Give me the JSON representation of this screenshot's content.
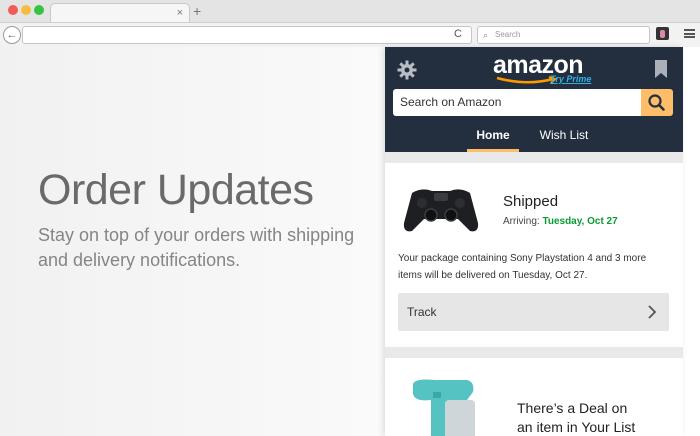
{
  "browser": {
    "traffic_lights": [
      "#ee5c55",
      "#f6bd45",
      "#33c441"
    ],
    "tab_close": "×",
    "new_tab": "+",
    "back_glyph": "←",
    "reload_glyph": "C",
    "search_icon": "search-icon",
    "search_placeholder": "Search"
  },
  "hero": {
    "title": "Order Updates",
    "subtitle": "Stay on top of your orders with shipping and delivery notifications."
  },
  "popup": {
    "logo_text": "amazon",
    "prime_link": "Try Prime",
    "search_placeholder": "Search on Amazon",
    "tabs": [
      {
        "label": "Home",
        "active": true
      },
      {
        "label": "Wish List",
        "active": false
      }
    ],
    "order": {
      "status": "Shipped",
      "arriving_label": "Arriving:",
      "arriving_date": "Tuesday, Oct 27",
      "message": "Your package containing Sony Playstation 4 and 3 more items will be delivered on Tuesday, Oct 27.",
      "track_label": "Track",
      "status_color": "#0a9b33"
    },
    "deal": {
      "line1": "There’s a Deal on",
      "line2": "an item in Your List"
    },
    "colors": {
      "header": "#232f3e",
      "accent": "#febd69",
      "prime": "#2fb1e6"
    }
  }
}
